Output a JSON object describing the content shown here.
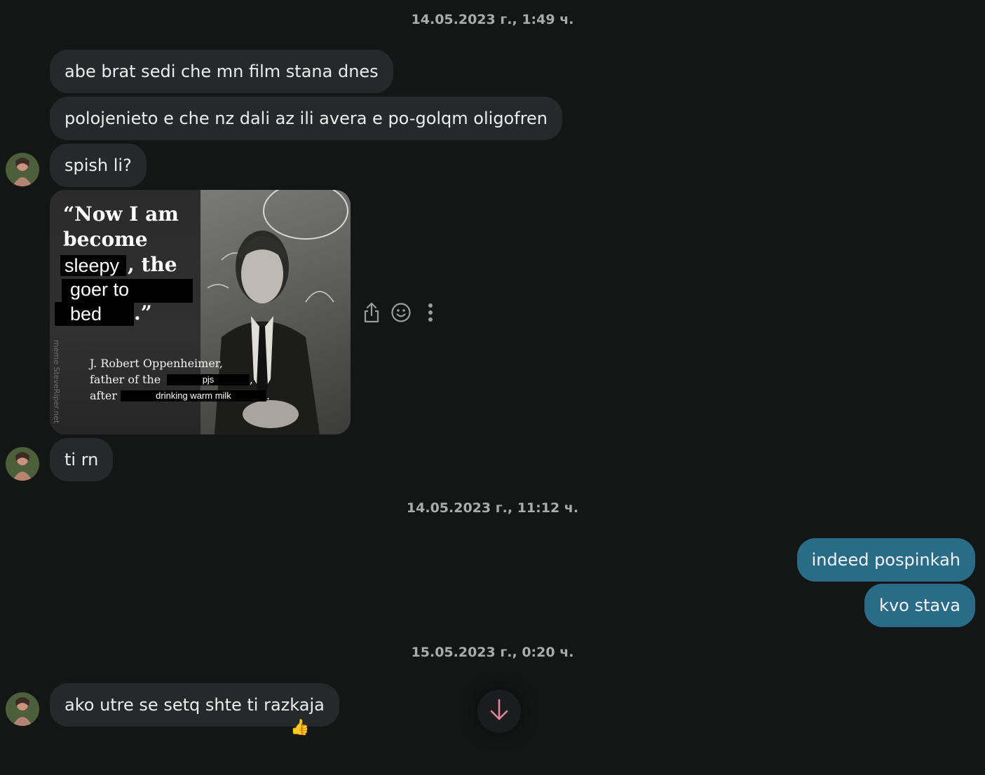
{
  "timestamps": [
    "14.05.2023 г., 1:49 ч.",
    "14.05.2023 г., 11:12 ч.",
    "15.05.2023 г., 0:20 ч."
  ],
  "messages": {
    "m1": "abe brat sedi che mn film stana dnes",
    "m2": "polojenieto e che nz dali az ili avera e po-golqm oligofren",
    "m3": "spish li?",
    "m4": "ti rn",
    "m5": "indeed pospinkah",
    "m6": "kvo stava",
    "m7": "ako utre se setq shte ti razkaja"
  },
  "meme": {
    "quote_line1": "“Now I am",
    "quote_line2": "become",
    "redact1": "sleepy",
    "quote_line3_tail": ", the",
    "redact2": "goer to",
    "redact3": "bed",
    "quote_close": ".”",
    "attrib_line1": "J. Robert Oppenheimer,",
    "attrib_line2": "father of the",
    "attrib_redact2": "pjs",
    "attrib_comma": ",",
    "attrib_line3": "after",
    "attrib_redact3": "drinking warm milk",
    "attrib_period": ".",
    "watermark": "meme SteveRiper.net"
  },
  "reaction": "👍",
  "icons": {
    "share": "share-icon",
    "react": "emoji-icon",
    "more": "more-vertical-icon",
    "scroll": "arrow-down-icon"
  },
  "colors": {
    "background": "#141616",
    "incoming_bubble": "#262829",
    "outgoing_bubble": "#2a6b87",
    "scroll_arrow": "#e0839c"
  }
}
